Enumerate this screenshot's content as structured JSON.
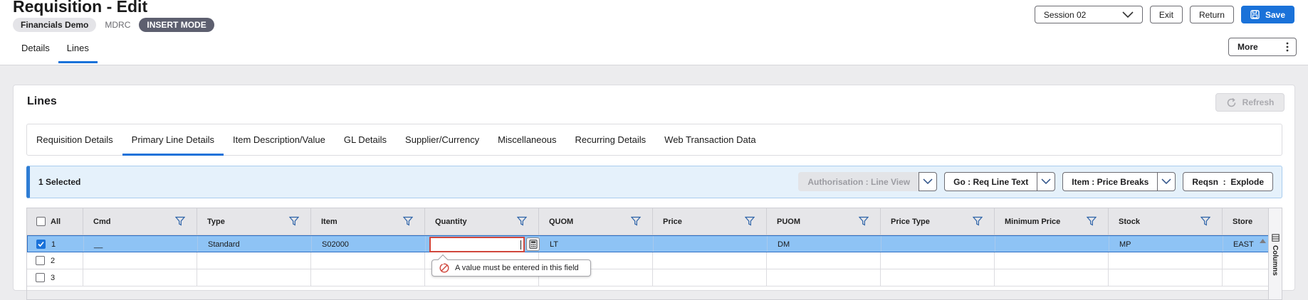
{
  "header": {
    "title": "Requisition - Edit",
    "environment": "Financials Demo",
    "env_code": "MDRC",
    "mode": "INSERT MODE",
    "session_label": "Session 02",
    "exit_label": "Exit",
    "return_label": "Return",
    "save_label": "Save",
    "more_label": "More",
    "tabs": [
      "Details",
      "Lines"
    ],
    "active_tab": "Lines"
  },
  "lines": {
    "title": "Lines",
    "refresh_label": "Refresh",
    "subtabs": [
      "Requisition Details",
      "Primary Line Details",
      "Item Description/Value",
      "GL Details",
      "Supplier/Currency",
      "Miscellaneous",
      "Recurring Details",
      "Web Transaction Data"
    ],
    "active_subtab": "Primary Line Details",
    "selection": {
      "count_text": "1 Selected",
      "actions": [
        {
          "label": "Authorisation : Line View",
          "type": "split",
          "disabled": true
        },
        {
          "label": "Go : Req Line Text",
          "type": "split",
          "disabled": false
        },
        {
          "label": "Item : Price Breaks",
          "type": "split",
          "disabled": false
        },
        {
          "label": "Reqsn  :  Explode",
          "type": "button",
          "disabled": false
        }
      ]
    },
    "grid": {
      "all_label": "All",
      "columns": [
        "Cmd",
        "Type",
        "Item",
        "Quantity",
        "QUOM",
        "Price",
        "PUOM",
        "Price Type",
        "Minimum Price",
        "Stock",
        "Store"
      ],
      "rows": [
        {
          "num": "1",
          "checked": true,
          "cells": [
            "__",
            "Standard",
            "S02000",
            "",
            "LT",
            "",
            "DM",
            "",
            "",
            "MP",
            "EAST"
          ]
        },
        {
          "num": "2",
          "checked": false,
          "cells": [
            "",
            "",
            "",
            "",
            "",
            "",
            "",
            "",
            "",
            "",
            ""
          ]
        },
        {
          "num": "3",
          "checked": false,
          "cells": [
            "",
            "",
            "",
            "",
            "",
            "",
            "",
            "",
            "",
            "",
            ""
          ]
        }
      ],
      "side_rail_label": "Columns",
      "validation_message": "A value must be entered in this field"
    }
  },
  "colors": {
    "accent": "#1a72d9",
    "selected_row": "#8ec3f5",
    "error": "#d0463c",
    "mode_pill": "#5d5f6f"
  }
}
